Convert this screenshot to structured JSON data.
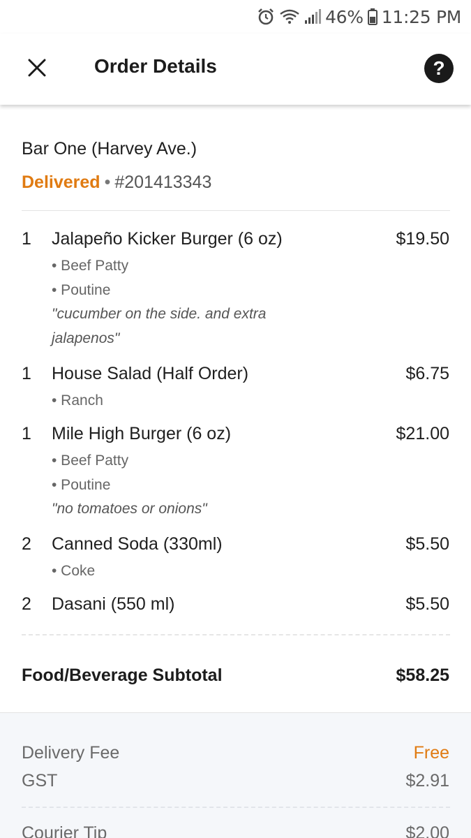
{
  "status_bar": {
    "battery": "46%",
    "time": "11:25 PM"
  },
  "header": {
    "title": "Order Details",
    "close_icon": "close-icon",
    "help_label": "?"
  },
  "order": {
    "restaurant": "Bar One (Harvey Ave.)",
    "status": "Delivered",
    "separator": "•",
    "number": "#201413343",
    "items": [
      {
        "qty": "1",
        "name": "Jalapeño Kicker Burger (6 oz)",
        "price": "$19.50",
        "modifiers": [
          "• Beef Patty",
          "• Poutine"
        ],
        "note": "\"cucumber on the side. and extra jalapenos\""
      },
      {
        "qty": "1",
        "name": "House Salad (Half Order)",
        "price": "$6.75",
        "modifiers": [
          "• Ranch"
        ]
      },
      {
        "qty": "1",
        "name": "Mile High Burger (6 oz)",
        "price": "$21.00",
        "modifiers": [
          "• Beef Patty",
          "• Poutine"
        ],
        "note": "\"no tomatoes or onions\""
      },
      {
        "qty": "2",
        "name": "Canned Soda (330ml)",
        "price": "$5.50",
        "modifiers": [
          "• Coke"
        ]
      },
      {
        "qty": "2",
        "name": "Dasani (550 ml)",
        "price": "$5.50"
      }
    ],
    "subtotal_label": "Food/Beverage Subtotal",
    "subtotal_value": "$58.25"
  },
  "fees": {
    "delivery_label": "Delivery Fee",
    "delivery_value": "Free",
    "gst_label": "GST",
    "gst_value": "$2.91",
    "tip_label": "Courier Tip",
    "tip_value": "$2.00"
  },
  "colors": {
    "accent": "#e07b12"
  }
}
